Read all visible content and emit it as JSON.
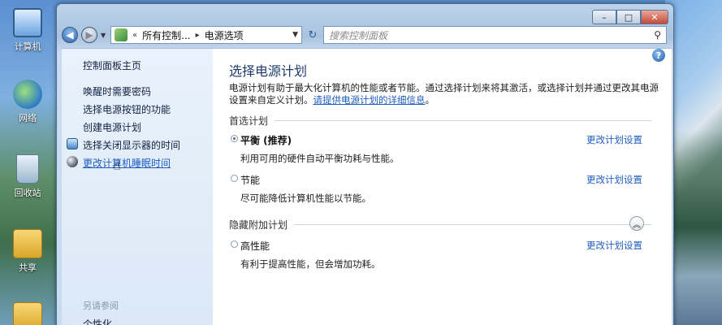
{
  "desktop": {
    "icons": [
      {
        "label": "计算机",
        "icon": "computer-icon"
      },
      {
        "label": "网络",
        "icon": "network-icon"
      },
      {
        "label": "回收站",
        "icon": "recycle-bin-icon"
      },
      {
        "label": "共享",
        "icon": "shared-folder-icon"
      }
    ]
  },
  "window": {
    "caption_buttons": {
      "minimize": "–",
      "maximize": "□",
      "close": "✕"
    }
  },
  "address_bar": {
    "crumb_root_arrow": "«",
    "crumb_1": "所有控制...",
    "crumb_sep": "▸",
    "crumb_2": "电源选项",
    "search_placeholder": "搜索控制面板"
  },
  "sidebar": {
    "home": "控制面板主页",
    "links": [
      "唤醒时需要密码",
      "选择电源按钮的功能",
      "创建电源计划",
      "选择关闭显示器的时间",
      "更改计算机睡眠时间"
    ],
    "see_also": "另请参阅",
    "bottom_link": "个性化"
  },
  "main": {
    "title": "选择电源计划",
    "desc_text": "电源计划有助于最大化计算机的性能或者节能。通过选择计划来将其激活，或选择计划并通过更改其电源设置来自定义计划。",
    "desc_link": "请提供电源计划的详细信息",
    "desc_end": "。",
    "preferred_heading": "首选计划",
    "hidden_heading": "隐藏附加计划",
    "plans": [
      {
        "name": "平衡 (推荐)",
        "desc": "利用可用的硬件自动平衡功耗与性能。",
        "link": "更改计划设置",
        "selected": true
      },
      {
        "name": "节能",
        "desc": "尽可能降低计算机性能以节能。",
        "link": "更改计划设置",
        "selected": false
      },
      {
        "name": "高性能",
        "desc": "有利于提高性能，但会增加功耗。",
        "link": "更改计划设置",
        "selected": false
      }
    ]
  }
}
